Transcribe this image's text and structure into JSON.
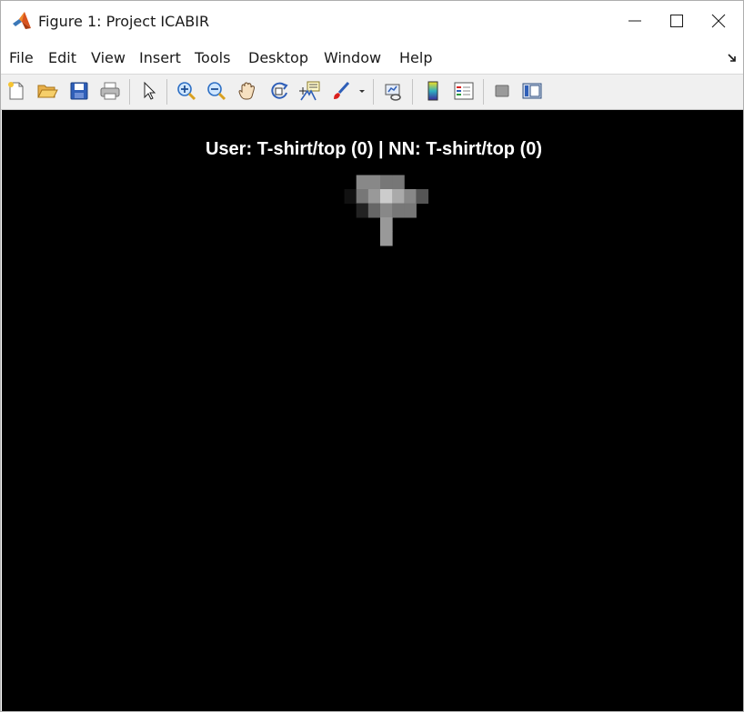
{
  "window": {
    "title": "Figure 1: Project ICABIR",
    "controls": [
      "minimize",
      "maximize",
      "close"
    ]
  },
  "menu": {
    "items": [
      "File",
      "Edit",
      "View",
      "Insert",
      "Tools",
      "Desktop",
      "Window",
      "Help"
    ]
  },
  "toolbar": {
    "buttons": [
      "new-figure-icon",
      "open-file-icon",
      "save-icon",
      "print-icon",
      "pointer-icon",
      "zoom-in-icon",
      "zoom-out-icon",
      "pan-icon",
      "rotate-3d-icon",
      "data-cursor-icon",
      "brush-icon",
      "link-plot-icon",
      "colorbar-icon",
      "legend-icon",
      "hide-plot-tools-icon",
      "show-plot-tools-icon"
    ]
  },
  "figure": {
    "title": "User: T-shirt/top (0) | NN: T-shirt/top (0)",
    "background": "#000000",
    "colormap": "gray",
    "image": {
      "rows": 28,
      "cols": 28,
      "pixels": [
        "0000000000000000000000000000",
        "0000000000008877000000000000",
        "00000000000179ca850000000000",
        "0000000000002687700000000000",
        "0000000000000090000000000000",
        "0000000000000090000000000000",
        "0000000000000000000000000000",
        "0000000000000000000000000000",
        "0000000000000000000000000000",
        "0000000000000000000000000000",
        "0000000000000000000000000000",
        "0000000000000000000000000000",
        "0000000000000000000000000000",
        "0000000000000000000000000000",
        "0000000000000000000000000000",
        "0000000000000000000000000000",
        "0000000000000000000000000000",
        "0000000000000000000000000000",
        "0000000000000000000000000000",
        "0000000000000000000000000000",
        "0000000000000000000000000000",
        "0000000000000000000000000000",
        "0000000000000000000000000000",
        "0000000000000000000000000000",
        "0000000000000000000000000000",
        "0000000000000000000000000000",
        "0000000000000000000000000000",
        "0000000000000000000000000000"
      ]
    }
  }
}
